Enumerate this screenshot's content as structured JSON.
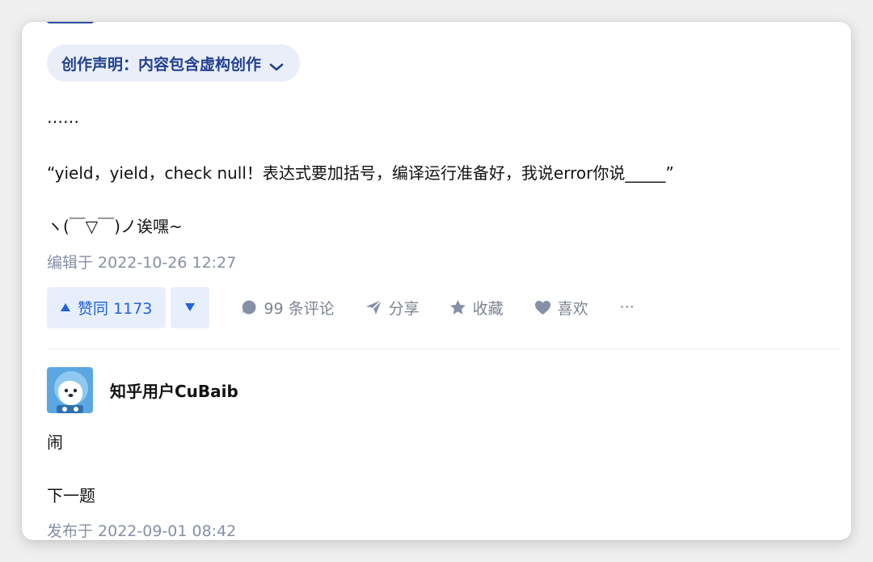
{
  "creation_statement": {
    "label": "创作声明：内容包含虚构创作",
    "chevron_icon": "chevron-down-icon"
  },
  "answer": {
    "lines": [
      "……",
      "“yield，yield，check null！表达式要加括号，编译运行准备好，我说error你说_____”",
      "ヽ(￣▽￣)ノ诶嘿~"
    ],
    "edited": "编辑于 2022-10-26 12:27"
  },
  "actions": {
    "upvote_label": "赞同 1173",
    "downvote_icon": "triangle-down-icon",
    "comment_label": "99 条评论",
    "share_label": "分享",
    "favorite_label": "收藏",
    "like_label": "喜欢",
    "more_label": "···"
  },
  "next_answer": {
    "username": "知乎用户CuBaib",
    "avatar_icon": "avatar-icon",
    "lines": [
      "闹",
      "下一题"
    ],
    "published": "发布于 2022-09-01 08:42"
  },
  "colors": {
    "accent": "#1f62e0",
    "pill_bg": "#e9eef8",
    "pill_text": "#23418f",
    "meta": "#8590a6"
  }
}
